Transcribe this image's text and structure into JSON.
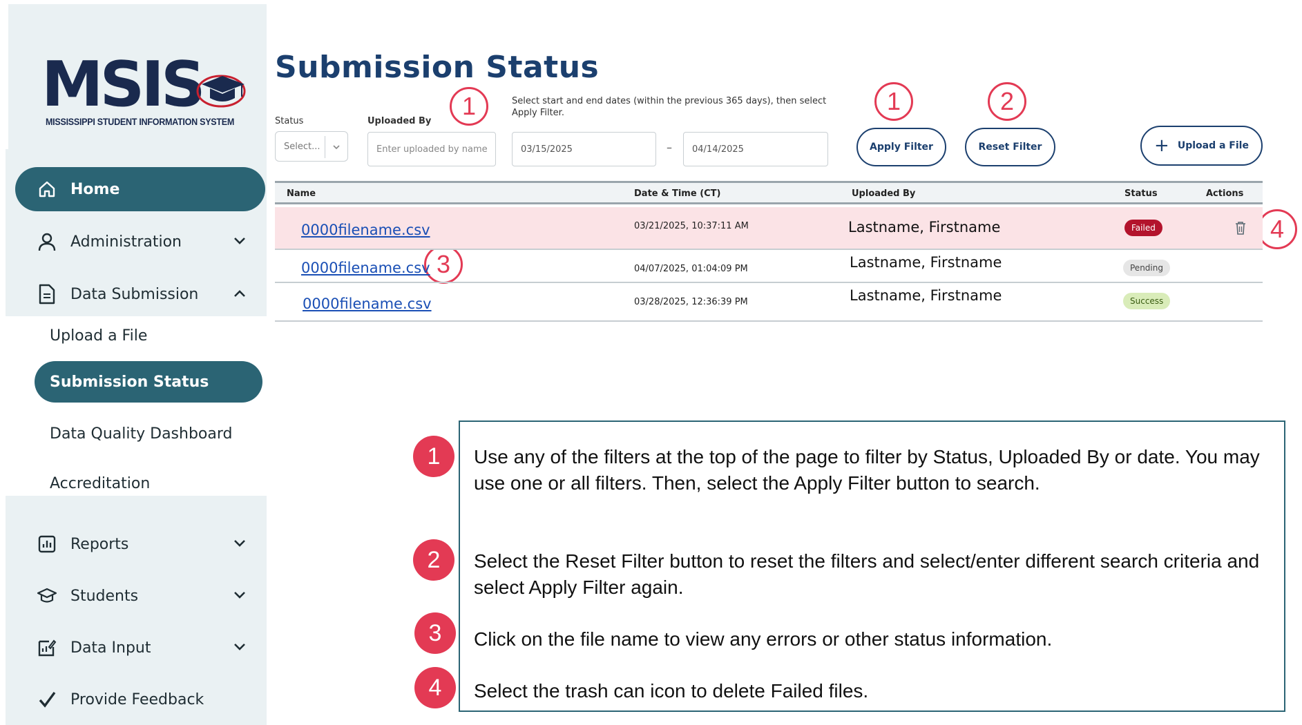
{
  "logo": {
    "text": "MSIS",
    "subtitle": "MISSISSIPPI STUDENT INFORMATION SYSTEM"
  },
  "sidebar": {
    "home": "Home",
    "administration": "Administration",
    "data_submission": "Data Submission",
    "sub_items": [
      "Upload a File",
      "Submission Status",
      "Data Quality Dashboard",
      "Accreditation"
    ],
    "reports": "Reports",
    "students": "Students",
    "data_input": "Data Input",
    "feedback": "Provide Feedback"
  },
  "page": {
    "title": "Submission Status"
  },
  "filters": {
    "status_label": "Status",
    "status_placeholder": "Select...",
    "uploaded_by_label": "Uploaded By",
    "uploaded_by_placeholder": "Enter uploaded by name",
    "date_hint": "Select start and end dates (within the previous 365 days), then select Apply Filter.",
    "start_date": "03/15/2025",
    "end_date": "04/14/2025",
    "date_separator": "–",
    "apply_label": "Apply Filter",
    "reset_label": "Reset Filter",
    "upload_label": "Upload a File",
    "upload_plus": "+"
  },
  "callouts": {
    "one": "1",
    "two": "2",
    "three": "3",
    "four": "4"
  },
  "table": {
    "headers": {
      "name": "Name",
      "datetime": "Date & Time (CT)",
      "uploaded_by": "Uploaded By",
      "status": "Status",
      "actions": "Actions"
    },
    "rows": [
      {
        "name": "0000filename.csv",
        "datetime": "03/21/2025, 10:37:11 AM",
        "uploaded_by": "Lastname, Firstname",
        "status": "Failed"
      },
      {
        "name": "0000filename.csv",
        "datetime": "04/07/2025, 01:04:09 PM",
        "uploaded_by": "Lastname, Firstname",
        "status": "Pending"
      },
      {
        "name": "0000filename.csv",
        "datetime": "03/28/2025, 12:36:39 PM",
        "uploaded_by": "Lastname, Firstname",
        "status": "Success"
      }
    ]
  },
  "instructions": [
    {
      "num": "1",
      "text": "Use any of the filters at the top of the page to filter by Status, Uploaded By or date.  You may use one or all filters. Then, select the Apply Filter button to search."
    },
    {
      "num": "2",
      "text": "Select the Reset Filter button to reset the filters and select/enter different search criteria and select Apply Filter again."
    },
    {
      "num": "3",
      "text": "Click on the file name to view any errors or other status information."
    },
    {
      "num": "4",
      "text": "Select the trash can icon to delete Failed files."
    }
  ],
  "colors": {
    "brand_teal": "#2b6474",
    "brand_navy": "#1b3f6e",
    "callout_red": "#e33a54",
    "failed": "#b3132c",
    "success_bg": "#d9ecb9"
  }
}
